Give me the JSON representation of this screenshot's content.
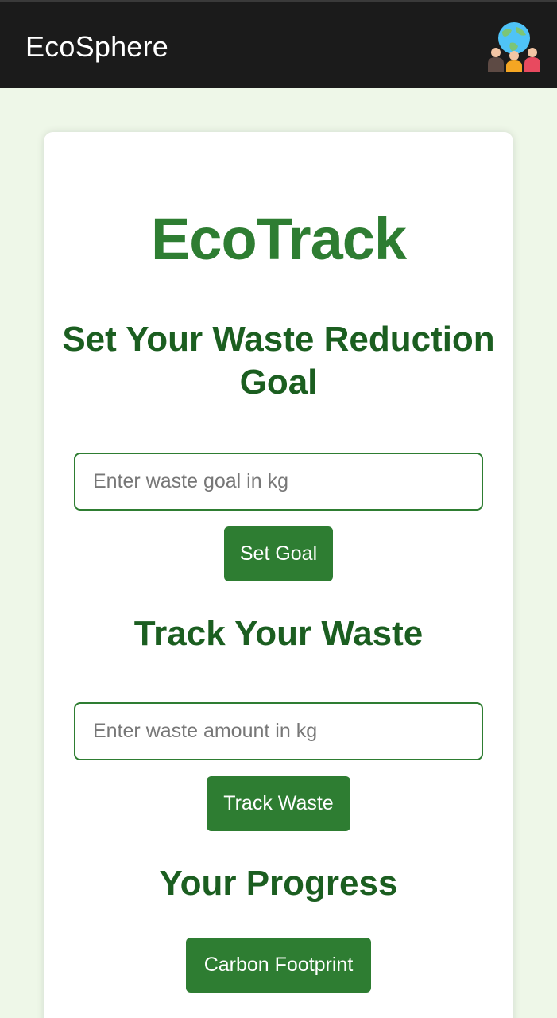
{
  "header": {
    "app_title": "EcoSphere",
    "logo_icon": "globe-people-icon"
  },
  "main": {
    "title": "EcoTrack",
    "goal_section": {
      "heading": "Set Your Waste Reduction Goal",
      "input_placeholder": "Enter waste goal in kg",
      "input_value": "",
      "button_label": "Set Goal"
    },
    "track_section": {
      "heading": "Track Your Waste",
      "input_placeholder": "Enter waste amount in kg",
      "input_value": "",
      "button_label": "Track Waste"
    },
    "progress_section": {
      "heading": "Your Progress",
      "button_label": "Carbon Footprint"
    }
  },
  "colors": {
    "background": "#eef7e8",
    "topbar": "#1b1b1b",
    "primary": "#2e7d32",
    "heading": "#1b5e20",
    "card": "#ffffff"
  }
}
